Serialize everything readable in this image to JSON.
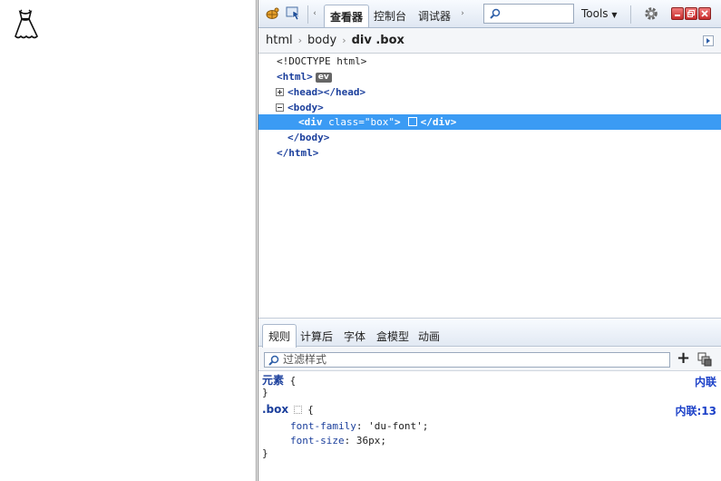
{
  "toolbar": {
    "tabs": [
      "查看器",
      "控制台",
      "调试器"
    ],
    "search_value": "",
    "tools_label": "Tools"
  },
  "breadcrumbs": [
    "html",
    "body",
    "div .box"
  ],
  "markup": {
    "doctype": "<!DOCTYPE html>",
    "html_open": "<html>",
    "ev_badge": "ev",
    "head_open": "<head>",
    "head_close": "</head>",
    "body_open": "<body>",
    "div_open_start": "<div",
    "div_attr": " class=\"box\"",
    "div_open_end": ">",
    "div_close": "</div>",
    "body_close": "</body>",
    "html_close": "</html>"
  },
  "rules_panel": {
    "tabs": [
      "规则",
      "计算后",
      "字体",
      "盒模型",
      "动画"
    ],
    "filter_placeholder": "过滤样式",
    "add_label": "+",
    "element_rule": {
      "selector": "元素",
      "open": " {",
      "close": "}",
      "source": "内联"
    },
    "box_rule": {
      "selector": ".box",
      "open": "{",
      "close": "}",
      "source": "内联:13",
      "declarations": [
        {
          "prop": "font-family",
          "value": "'du-font'"
        },
        {
          "prop": "font-size",
          "value": "36px"
        }
      ]
    }
  },
  "colors": {
    "selection": "#3b9bf4",
    "tag": "#1b3f9c",
    "source_link": "#1c41c8"
  }
}
